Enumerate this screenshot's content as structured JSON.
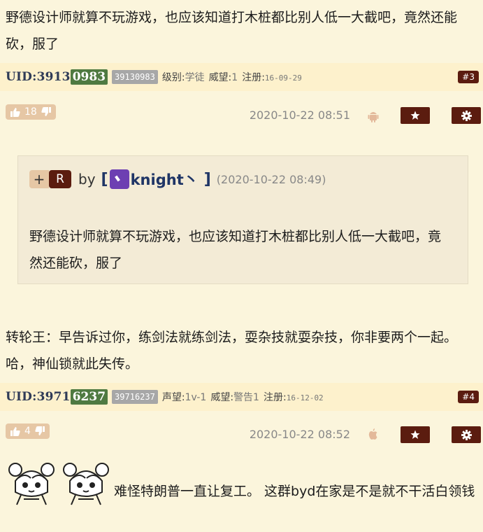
{
  "posts": [
    {
      "body": "野德设计师就算不玩游戏，也应该知道打木桩都比别人低一大截吧，竟然还能砍，服了",
      "uid_prefix": "UID:3913",
      "uid_highlight": "0983",
      "uid_full": "39130983",
      "meta1_key": "级别:",
      "meta1_val": "学徒",
      "meta2_key": "威望:",
      "meta2_val": "1",
      "reg_key": "注册:",
      "reg_date": "16-09-29",
      "floor": "#3",
      "likes": "18",
      "time": "2020-10-22 08:51",
      "os": "android-icon",
      "quote": {
        "plus": "+",
        "r": "R",
        "by": "by",
        "open": "[",
        "name": "knight丶",
        "close": "]",
        "time": "(2020-10-22 08:49)",
        "text": "野德设计师就算不玩游戏，也应该知道打木桩都比别人低一大截吧，竟然还能砍，服了"
      },
      "reply": "转轮王：早告诉过你，练剑法就练剑法，耍杂技就耍杂技，你非要两个一起。哈，神仙锁就此失传。"
    },
    {
      "uid_prefix": "UID:3971",
      "uid_highlight": "6237",
      "uid_full": "39716237",
      "meta1_key": "声望:",
      "meta1_val": "1v-1",
      "meta2_key": "威望:",
      "meta2_val": "警告1",
      "reg_key": "注册:",
      "reg_date": "16-12-02",
      "floor": "#4",
      "likes": "4",
      "time": "2020-10-22 08:52",
      "os": "apple-icon",
      "body": "难怪特朗普一直让复工。 这群byd在家是不是就不干活白领钱"
    }
  ],
  "colors": {
    "page_bg": "#fbf5dc",
    "meta_bg": "#fdf1cc",
    "accent_dark": "#5b1c0f",
    "uid_green": "#4f7a41",
    "like_pill": "#e6c7a5",
    "quote_bg": "#f3ebd6",
    "name_blue": "#1f3566"
  }
}
